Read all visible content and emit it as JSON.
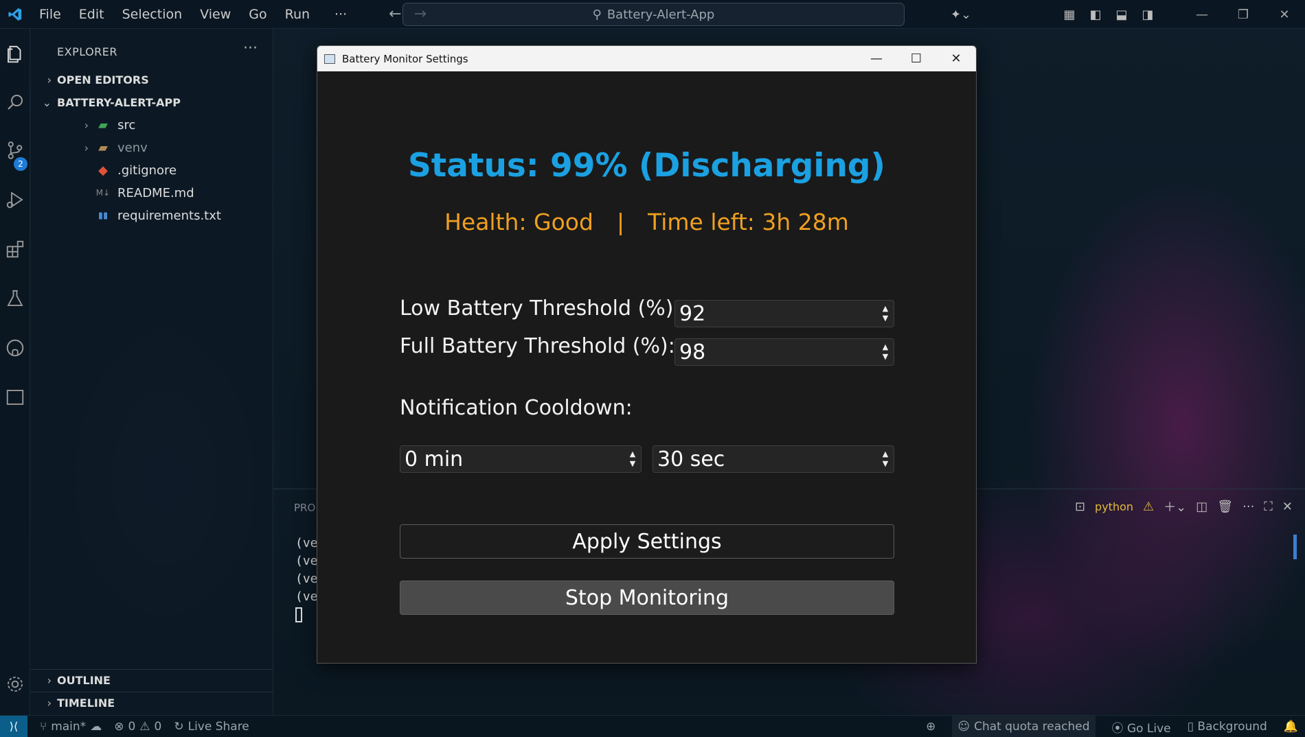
{
  "titlebar": {
    "menu": [
      "File",
      "Edit",
      "Selection",
      "View",
      "Go",
      "Run"
    ],
    "more": "···",
    "search_text": "Battery-Alert-App"
  },
  "activity_bar": {
    "scm_badge": "2"
  },
  "sidebar": {
    "title": "EXPLORER",
    "more": "···",
    "open_editors": "OPEN EDITORS",
    "project": "BATTERY-ALERT-APP",
    "items": [
      {
        "label": "src",
        "icon": "folder-src-icon"
      },
      {
        "label": "venv",
        "icon": "folder-icon"
      },
      {
        "label": ".gitignore",
        "icon": "git-icon"
      },
      {
        "label": "README.md",
        "icon": "markdown-icon"
      },
      {
        "label": "requirements.txt",
        "icon": "pip-icon"
      }
    ],
    "outline": "OUTLINE",
    "timeline": "TIMELINE"
  },
  "panel": {
    "tab": "PRO",
    "lines": [
      "(ve",
      "(ve",
      "(ve",
      "(ve"
    ],
    "terminal_name": "python"
  },
  "statusbar": {
    "branch": "main*",
    "errors": "0",
    "warnings": "0",
    "live_share": "Live Share",
    "chat_quota": "Chat quota reached",
    "go_live": "Go Live",
    "background": "Background"
  },
  "battery_window": {
    "title": "Battery Monitor Settings",
    "status_text": "Status: 99% (Discharging)",
    "health_text": "Health: Good",
    "separator": "|",
    "time_left_text": "Time left: 3h 28m",
    "low_label": "Low Battery Threshold (%):",
    "low_value": "92",
    "full_label": "Full Battery Threshold (%):",
    "full_value": "98",
    "cooldown_label": "Notification Cooldown:",
    "cooldown_min": "0 min",
    "cooldown_sec": "30 sec",
    "apply_button": "Apply Settings",
    "stop_button": "Stop Monitoring"
  },
  "colors": {
    "status_blue": "#1ba1e2",
    "health_orange": "#f0a020",
    "accent": "#1e7bd6"
  }
}
